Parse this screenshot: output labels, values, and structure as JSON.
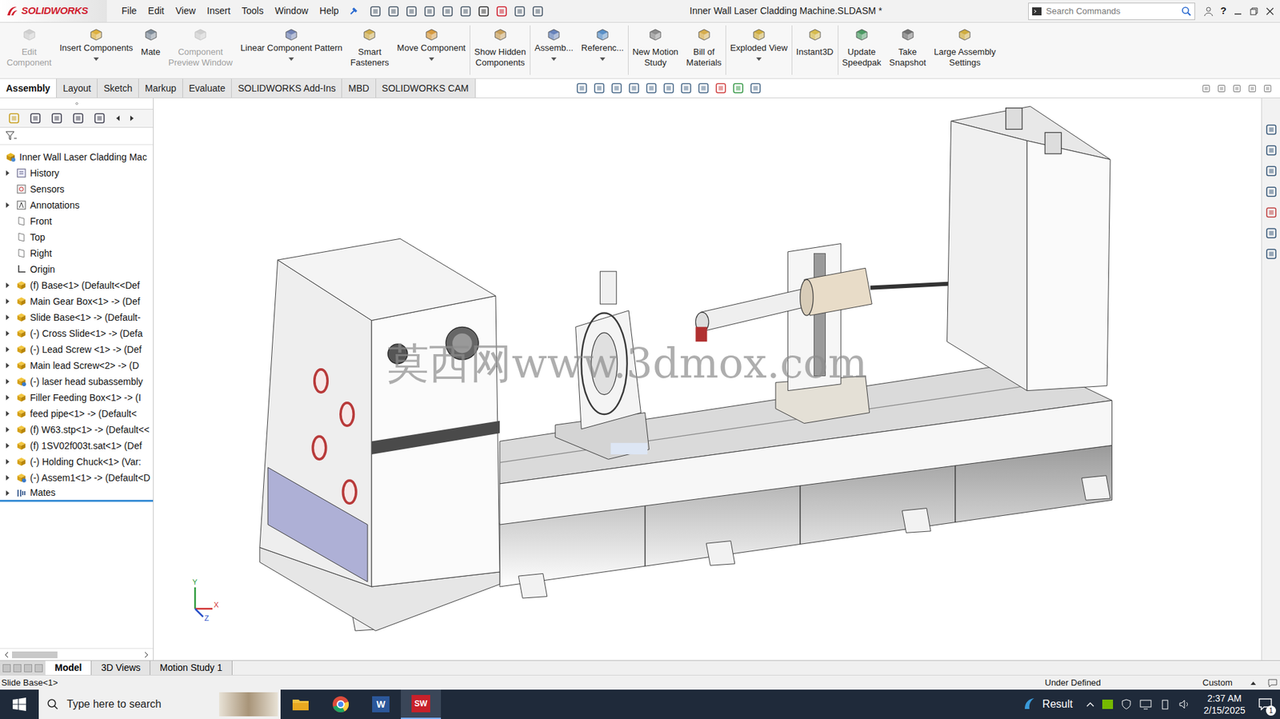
{
  "window": {
    "logo": "SOLIDWORKS",
    "title": "Inner Wall Laser Cladding Machine.SLDASM *",
    "help": "?"
  },
  "menu": [
    "File",
    "Edit",
    "View",
    "Insert",
    "Tools",
    "Window",
    "Help"
  ],
  "search": {
    "placeholder": "Search Commands"
  },
  "ribbon": [
    {
      "lines": [
        "Edit",
        "Component"
      ],
      "disabled": true,
      "dropdown": false,
      "separator_after": false
    },
    {
      "lines": [
        "Insert Components"
      ],
      "disabled": false,
      "dropdown": true,
      "separator_after": false
    },
    {
      "lines": [
        "Mate"
      ],
      "disabled": false,
      "dropdown": false,
      "separator_after": false
    },
    {
      "lines": [
        "Component",
        "Preview Window"
      ],
      "disabled": true,
      "dropdown": false,
      "separator_after": false
    },
    {
      "lines": [
        "Linear Component Pattern"
      ],
      "disabled": false,
      "dropdown": true,
      "separator_after": false
    },
    {
      "lines": [
        "Smart",
        "Fasteners"
      ],
      "disabled": false,
      "dropdown": false,
      "separator_after": false
    },
    {
      "lines": [
        "Move Component"
      ],
      "disabled": false,
      "dropdown": true,
      "separator_after": true
    },
    {
      "lines": [
        "Show Hidden",
        "Components"
      ],
      "disabled": false,
      "dropdown": false,
      "separator_after": true
    },
    {
      "lines": [
        "Assemb..."
      ],
      "disabled": false,
      "dropdown": true,
      "separator_after": false
    },
    {
      "lines": [
        "Referenc..."
      ],
      "disabled": false,
      "dropdown": true,
      "separator_after": true
    },
    {
      "lines": [
        "New Motion",
        "Study"
      ],
      "disabled": false,
      "dropdown": false,
      "separator_after": false
    },
    {
      "lines": [
        "Bill of",
        "Materials"
      ],
      "disabled": false,
      "dropdown": false,
      "separator_after": true
    },
    {
      "lines": [
        "Exploded View"
      ],
      "disabled": false,
      "dropdown": true,
      "separator_after": true
    },
    {
      "lines": [
        "Instant3D"
      ],
      "disabled": false,
      "dropdown": false,
      "separator_after": true
    },
    {
      "lines": [
        "Update",
        "Speedpak"
      ],
      "disabled": false,
      "dropdown": false,
      "separator_after": false
    },
    {
      "lines": [
        "Take",
        "Snapshot"
      ],
      "disabled": false,
      "dropdown": false,
      "separator_after": false
    },
    {
      "lines": [
        "Large Assembly",
        "Settings"
      ],
      "disabled": false,
      "dropdown": false,
      "separator_after": false
    }
  ],
  "tabs": [
    {
      "label": "Assembly",
      "selected": true
    },
    {
      "label": "Layout",
      "selected": false
    },
    {
      "label": "Sketch",
      "selected": false
    },
    {
      "label": "Markup",
      "selected": false
    },
    {
      "label": "Evaluate",
      "selected": false
    },
    {
      "label": "SOLIDWORKS Add-Ins",
      "selected": false
    },
    {
      "label": "MBD",
      "selected": false
    },
    {
      "label": "SOLIDWORKS CAM",
      "selected": false
    }
  ],
  "tree": [
    {
      "label": "Inner Wall Laser Cladding Mac",
      "kind": "root",
      "expandable": false
    },
    {
      "label": "History",
      "kind": "history",
      "expandable": true
    },
    {
      "label": "Sensors",
      "kind": "sensor",
      "expandable": false
    },
    {
      "label": "Annotations",
      "kind": "annotation",
      "expandable": true
    },
    {
      "label": "Front",
      "kind": "plane",
      "expandable": false
    },
    {
      "label": "Top",
      "kind": "plane",
      "expandable": false
    },
    {
      "label": "Right",
      "kind": "plane",
      "expandable": false
    },
    {
      "label": "Origin",
      "kind": "origin",
      "expandable": false
    },
    {
      "label": "(f) Base<1> (Default<<Def",
      "kind": "assembly",
      "expandable": true
    },
    {
      "label": "Main Gear Box<1> -> (Def",
      "kind": "assembly",
      "expandable": true
    },
    {
      "label": "Slide Base<1> -> (Default-",
      "kind": "assembly",
      "expandable": true
    },
    {
      "label": "(-) Cross Slide<1> -> (Defa",
      "kind": "assembly",
      "expandable": true
    },
    {
      "label": "(-) Lead Screw <1> -> (Def",
      "kind": "assembly",
      "expandable": true
    },
    {
      "label": "Main lead Screw<2> -> (D",
      "kind": "assembly",
      "expandable": true
    },
    {
      "label": "(-) laser head subassembly",
      "kind": "subassembly",
      "expandable": true
    },
    {
      "label": "Filler Feeding Box<1> -> (I",
      "kind": "assembly",
      "expandable": true
    },
    {
      "label": "feed pipe<1> -> (Default<",
      "kind": "assembly",
      "expandable": true
    },
    {
      "label": "(f) W63.stp<1> -> (Default<<",
      "kind": "assembly",
      "expandable": true
    },
    {
      "label": "(f) 1SV02f003t.sat<1> (Def",
      "kind": "assembly",
      "expandable": true
    },
    {
      "label": "(-) Holding Chuck<1> (Var:",
      "kind": "assembly",
      "expandable": true
    },
    {
      "label": "(-) Assem1<1> -> (Default<D",
      "kind": "subassembly",
      "expandable": true
    },
    {
      "label": "Mates",
      "kind": "mates",
      "expandable": true
    }
  ],
  "watermark": "莫西网www.3dmox.com",
  "triad": {
    "y": "Y",
    "x": "X",
    "z": "Z"
  },
  "bottom_tabs": [
    {
      "label": "Model",
      "selected": true
    },
    {
      "label": "3D Views",
      "selected": false
    },
    {
      "label": "Motion Study 1",
      "selected": false
    }
  ],
  "status_bar": {
    "selection": "Slide Base<1>",
    "state": "Under Defined",
    "units": "Custom"
  },
  "taskbar": {
    "search_placeholder": "Type here to search",
    "word_glyph": "W",
    "sw_glyph": "SW",
    "weather": "Result",
    "time": "2:37 AM",
    "date": "2/15/2025",
    "notifications": "1"
  }
}
